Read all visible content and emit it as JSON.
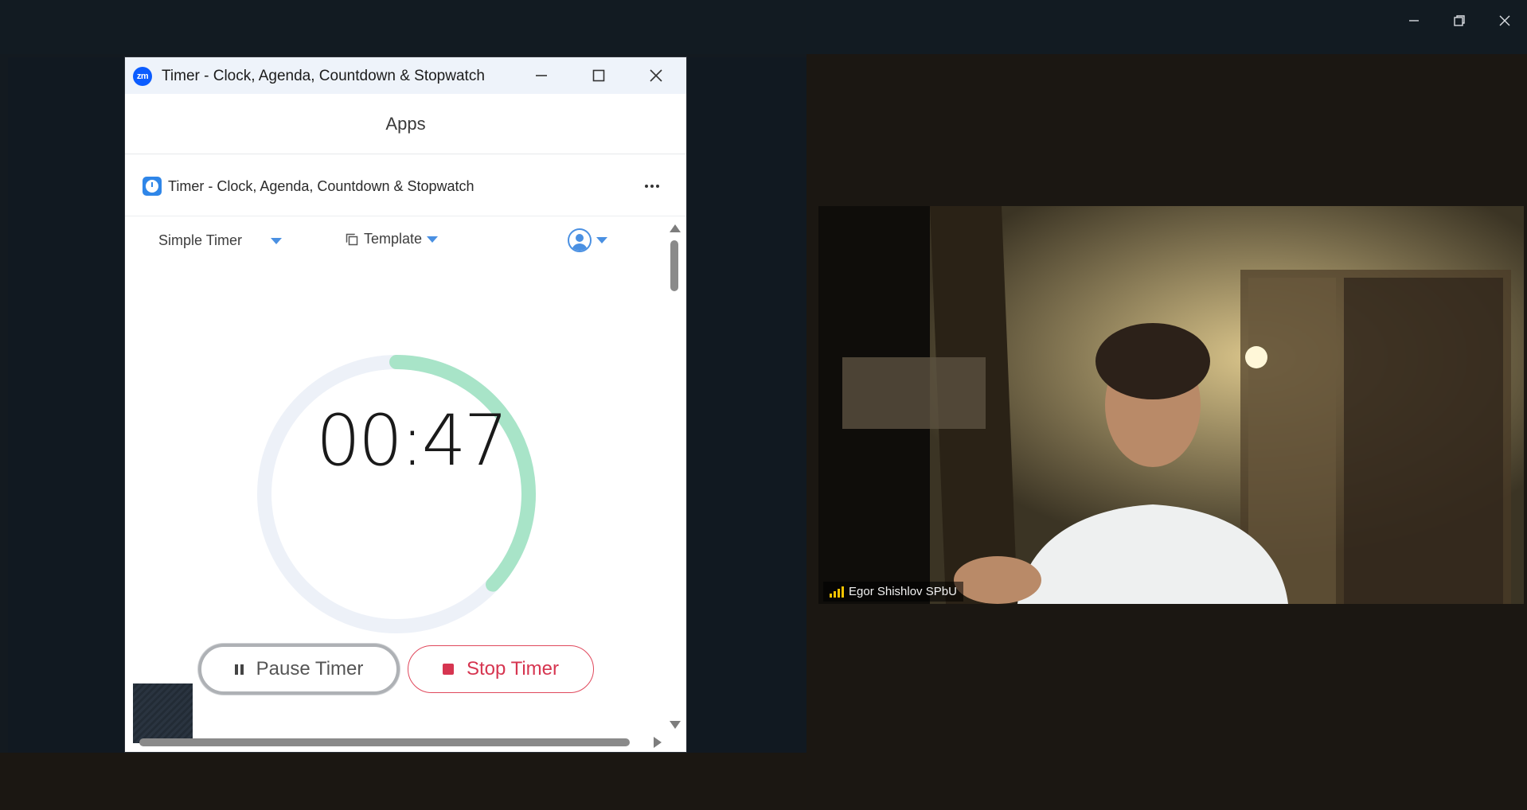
{
  "window": {
    "controls": [
      "minimize-icon",
      "restore-icon",
      "close-icon"
    ]
  },
  "popup": {
    "title": "Timer - Clock, Agenda, Countdown & Stopwatch",
    "logo_text": "zm",
    "header": "Apps",
    "app_name": "Timer - Clock, Agenda, Countdown & Stopwatch",
    "mode": "Simple Timer",
    "template_label": "Template",
    "time": "00:47",
    "progress_fraction": 0.37,
    "pause_label": "Pause Timer",
    "stop_label": "Stop Timer"
  },
  "video": {
    "participant_name": "Egor Shishlov SPbU"
  },
  "colors": {
    "ring_progress": "#a8e4c8",
    "ring_track": "#edf1f8",
    "stop_accent": "#d63550",
    "accent_blue": "#4a90e2"
  }
}
